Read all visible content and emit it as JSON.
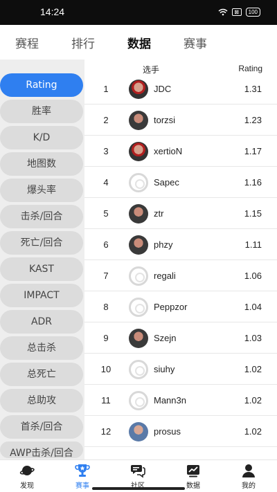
{
  "status_bar": {
    "time": "14:24",
    "battery": "100",
    "sim": "⊠"
  },
  "top_tabs": [
    "赛程",
    "排行",
    "数据",
    "赛事"
  ],
  "sidebar": {
    "items": [
      "Rating",
      "胜率",
      "K/D",
      "地图数",
      "爆头率",
      "击杀/回合",
      "死亡/回合",
      "KAST",
      "IMPACT",
      "ADR",
      "总击杀",
      "总死亡",
      "总助攻",
      "首杀/回合",
      "AWP击杀/回合"
    ]
  },
  "table": {
    "header_player": "选手",
    "header_rating": "Rating",
    "rows": [
      {
        "rank": "1",
        "name": "JDC",
        "rating": "1.31",
        "avatar": "photo-red"
      },
      {
        "rank": "2",
        "name": "torzsi",
        "rating": "1.23",
        "avatar": "photo"
      },
      {
        "rank": "3",
        "name": "xertioN",
        "rating": "1.17",
        "avatar": "photo-red"
      },
      {
        "rank": "4",
        "name": "Sapec",
        "rating": "1.16",
        "avatar": "placeholder"
      },
      {
        "rank": "5",
        "name": "ztr",
        "rating": "1.15",
        "avatar": "photo"
      },
      {
        "rank": "6",
        "name": "phzy",
        "rating": "1.11",
        "avatar": "photo"
      },
      {
        "rank": "7",
        "name": "regali",
        "rating": "1.06",
        "avatar": "placeholder"
      },
      {
        "rank": "8",
        "name": "Peppzor",
        "rating": "1.04",
        "avatar": "placeholder"
      },
      {
        "rank": "9",
        "name": "Szejn",
        "rating": "1.03",
        "avatar": "photo"
      },
      {
        "rank": "10",
        "name": "siuhy",
        "rating": "1.02",
        "avatar": "placeholder"
      },
      {
        "rank": "11",
        "name": "Mann3n",
        "rating": "1.02",
        "avatar": "placeholder"
      },
      {
        "rank": "12",
        "name": "prosus",
        "rating": "1.02",
        "avatar": "photo-blue"
      }
    ]
  },
  "bottom_nav": [
    "发现",
    "赛事",
    "社区",
    "数据",
    "我的"
  ],
  "colors": {
    "accent": "#2f7ff0",
    "sidebar_bg": "#eeeeee",
    "pill_bg": "#dcdcdc"
  }
}
